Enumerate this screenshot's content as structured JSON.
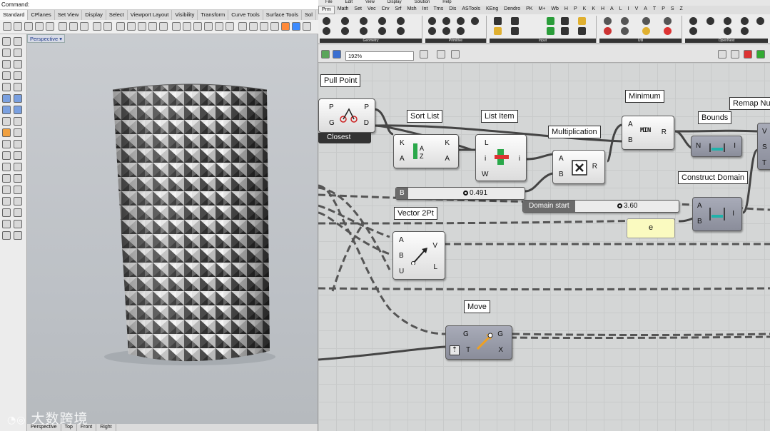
{
  "rhino": {
    "command_label": "Command:",
    "tabs": [
      "Standard",
      "CPlanes",
      "Set View",
      "Display",
      "Select",
      "Viewport Layout",
      "Visibility",
      "Transform",
      "Curve Tools",
      "Surface Tools",
      "Sol"
    ],
    "viewport_title": "Perspective",
    "viewport_tabs": [
      "Perspective",
      "Top",
      "Front",
      "Right"
    ],
    "watermark": "大数跨境"
  },
  "gh": {
    "menu": [
      "File",
      "Edit",
      "View",
      "Display",
      "Solution",
      "Help"
    ],
    "tabs": [
      "Prm",
      "Math",
      "Set",
      "Vec",
      "Crv",
      "Srf",
      "Msh",
      "Int",
      "Trns",
      "Dis",
      "ASTools",
      "KEng",
      "Dendro",
      "PK",
      "M+",
      "Wb",
      "H",
      "P",
      "K",
      "K",
      "H",
      "A",
      "L",
      "I",
      "V",
      "A",
      "T",
      "P",
      "S",
      "Z"
    ],
    "ribbon_groups": [
      "Geometry",
      "Primitive",
      "Input",
      "Util",
      "OpenNest"
    ],
    "zoom": "192%",
    "components": {
      "pull_point": {
        "label": "Pull Point",
        "inputs": [
          "P",
          "G"
        ],
        "outputs": [
          "P",
          "D"
        ],
        "flag": "Closest"
      },
      "sort_list": {
        "label": "Sort List",
        "inputs": [
          "K",
          "A"
        ],
        "outputs": [
          "K",
          "A"
        ]
      },
      "list_item": {
        "label": "List Item",
        "inputs": [
          "L",
          "i",
          "W"
        ],
        "outputs": [
          "i"
        ]
      },
      "multiplication": {
        "label": "Multiplication",
        "inputs": [
          "A",
          "B"
        ],
        "outputs": [
          "R"
        ]
      },
      "minimum": {
        "label": "Minimum",
        "inputs": [
          "A",
          "B"
        ],
        "outputs": [
          "R"
        ],
        "icon_text": "MIN"
      },
      "bounds": {
        "label": "Bounds",
        "inputs": [
          "N"
        ],
        "outputs": [
          "I"
        ]
      },
      "remap": {
        "label": "Remap Nu",
        "inputs": [
          "V",
          "S",
          "T"
        ]
      },
      "construct_domain": {
        "label": "Construct Domain",
        "inputs": [
          "A",
          "B"
        ],
        "outputs": [
          "I"
        ]
      },
      "vector_2pt": {
        "label": "Vector 2Pt",
        "inputs": [
          "A",
          "B",
          "U"
        ],
        "outputs": [
          "V",
          "L"
        ]
      },
      "move": {
        "label": "Move",
        "inputs": [
          "G",
          "T"
        ],
        "outputs": [
          "G",
          "X"
        ]
      }
    },
    "sliders": {
      "b": {
        "tag": "B",
        "value": "0.491"
      },
      "domain_start": {
        "tag": "Domain start",
        "value": "3.60"
      }
    },
    "panel_e": "e"
  }
}
